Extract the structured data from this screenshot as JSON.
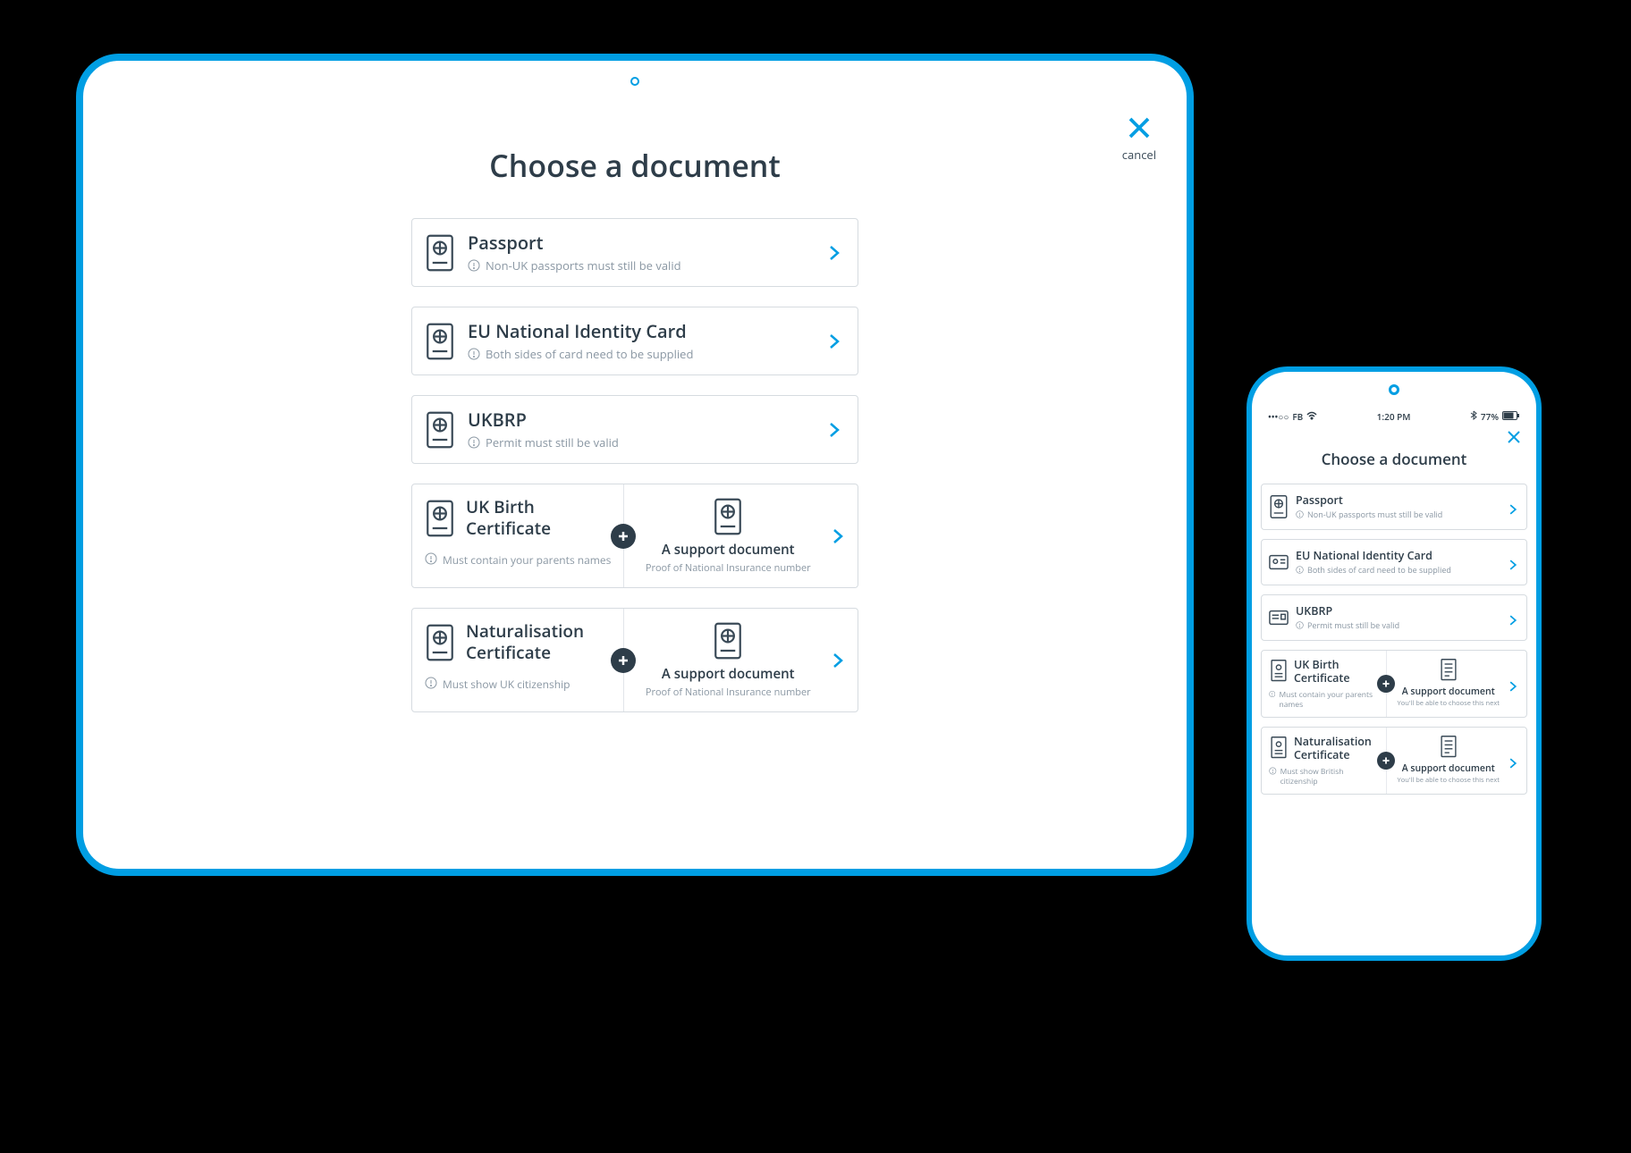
{
  "colors": {
    "accent": "#009ee3",
    "text": "#2e3d49",
    "muted": "#8a97a3",
    "border": "#d6dbe0"
  },
  "tablet": {
    "cancel_label": "cancel",
    "title": "Choose a document",
    "options": [
      {
        "title": "Passport",
        "hint": "Non-UK passports must still be valid",
        "icon": "passport"
      },
      {
        "title": "EU National Identity Card",
        "hint": "Both sides of card need to be supplied",
        "icon": "id-card"
      },
      {
        "title": "UKBRP",
        "hint": "Permit must still be valid",
        "icon": "permit"
      },
      {
        "split": true,
        "left": {
          "title": "UK Birth Certificate",
          "hint": "Must contain your parents names",
          "icon": "certificate"
        },
        "right": {
          "title": "A support document",
          "sub": "Proof of National Insurance number",
          "icon": "document"
        }
      },
      {
        "split": true,
        "left": {
          "title": "Naturalisation Certificate",
          "hint": "Must show UK citizenship",
          "icon": "certificate"
        },
        "right": {
          "title": "A support document",
          "sub": "Proof of National Insurance number",
          "icon": "document"
        }
      }
    ]
  },
  "phone": {
    "status": {
      "carrier": "FB",
      "time": "1:20 PM",
      "battery": "77%"
    },
    "title": "Choose a document",
    "options": [
      {
        "title": "Passport",
        "hint": "Non-UK passports must still be valid",
        "icon": "passport"
      },
      {
        "title": "EU National Identity Card",
        "hint": "Both sides of card need to be supplied",
        "icon": "id-card"
      },
      {
        "title": "UKBRP",
        "hint": "Permit must still be valid",
        "icon": "permit"
      },
      {
        "split": true,
        "left": {
          "title": "UK Birth Certificate",
          "hint": "Must contain your parents names",
          "icon": "certificate"
        },
        "right": {
          "title": "A support document",
          "sub": "You'll be able to choose this next",
          "icon": "document"
        }
      },
      {
        "split": true,
        "left": {
          "title": "Naturalisation Certificate",
          "hint": "Must show British citizenship",
          "icon": "certificate"
        },
        "right": {
          "title": "A support document",
          "sub": "You'll be able to choose this next",
          "icon": "document"
        }
      }
    ]
  }
}
